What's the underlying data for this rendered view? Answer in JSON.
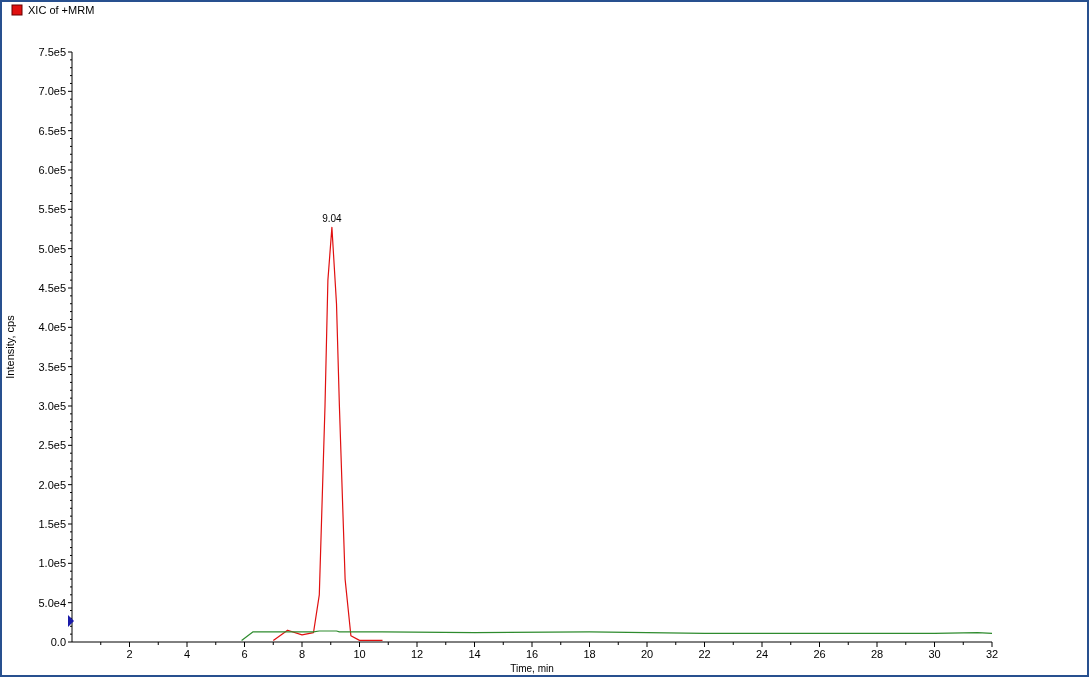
{
  "chart_data": {
    "type": "line",
    "xlabel": "Time, min",
    "ylabel": "Intensity, cps",
    "x": [
      5.9,
      6.3,
      7,
      7.5,
      8,
      8.4,
      8.6,
      8.8,
      8.9,
      9.04,
      9.2,
      9.3,
      9.5,
      9.7,
      10,
      10.8,
      14,
      18,
      22,
      26,
      30,
      31.5,
      32
    ],
    "series": [
      {
        "name": "XIC of +MRM",
        "color": "#e01010",
        "values": [
          null,
          null,
          2000,
          15000,
          9000,
          12000,
          60000,
          300000,
          460000,
          527000,
          430000,
          300000,
          80000,
          8000,
          2000,
          2000,
          null,
          null,
          null,
          null,
          null,
          null,
          null
        ]
      },
      {
        "color": "#2e8b2e",
        "values": [
          2000,
          13000,
          13000,
          13000,
          13000,
          13000,
          14000,
          14000,
          14000,
          14000,
          14000,
          13000,
          13000,
          13000,
          13000,
          13000,
          12000,
          13000,
          11000,
          11000,
          11000,
          12000,
          11000
        ]
      }
    ],
    "xlim": [
      0,
      32
    ],
    "ylim": [
      0,
      750000
    ],
    "xticks": [
      2,
      4,
      6,
      8,
      10,
      12,
      14,
      16,
      18,
      20,
      22,
      24,
      26,
      28,
      30,
      32
    ],
    "yticks": [
      {
        "value": 0,
        "label": "0.0"
      },
      {
        "value": 50000,
        "label": "5.0e4"
      },
      {
        "value": 100000,
        "label": "1.0e5"
      },
      {
        "value": 150000,
        "label": "1.5e5"
      },
      {
        "value": 200000,
        "label": "2.0e5"
      },
      {
        "value": 250000,
        "label": "2.5e5"
      },
      {
        "value": 300000,
        "label": "3.0e5"
      },
      {
        "value": 350000,
        "label": "3.5e5"
      },
      {
        "value": 400000,
        "label": "4.0e5"
      },
      {
        "value": 450000,
        "label": "4.5e5"
      },
      {
        "value": 500000,
        "label": "5.0e5"
      },
      {
        "value": 550000,
        "label": "5.5e5"
      },
      {
        "value": 600000,
        "label": "6.0e5"
      },
      {
        "value": 650000,
        "label": "6.5e5"
      },
      {
        "value": 700000,
        "label": "7.0e5"
      },
      {
        "value": 750000,
        "label": "7.5e5"
      }
    ],
    "annotations": [
      {
        "x": 9.04,
        "y": 527000,
        "text": "9.04"
      }
    ]
  }
}
